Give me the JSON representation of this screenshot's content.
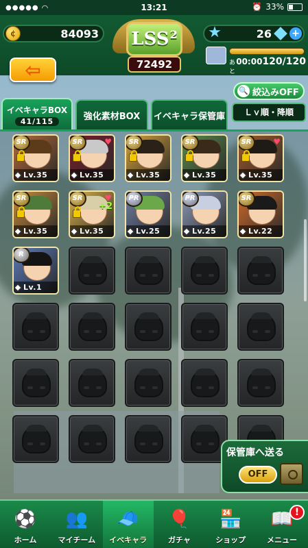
{
  "status_bar": {
    "signal": "●●●●●",
    "time": "13:21",
    "battery": "33%"
  },
  "header": {
    "coins": "84093",
    "rank_emblem": "LSS",
    "rank_superscript": "2",
    "rank_points": "72492",
    "stars": "26",
    "stamina_prefix": "あと",
    "stamina_timer": "00:00",
    "stamina_count": "120/120",
    "stamina_fraction": 1.0
  },
  "tabs": [
    {
      "label": "イベキャラBOX",
      "count": "41/115",
      "active": true
    },
    {
      "label": "強化素材BOX",
      "active": false
    },
    {
      "label": "イベキャラ保管庫",
      "active": false
    }
  ],
  "filter": {
    "label": "絞込みOFF",
    "sort": "Ｌｖ順・降順"
  },
  "characters": [
    {
      "rarity": "SR",
      "level": "Lv.35",
      "locked": true,
      "heart": false,
      "plus": "",
      "hair": "#5b3b1a",
      "bg": "#b66a3a"
    },
    {
      "rarity": "SR",
      "level": "Lv.35",
      "locked": true,
      "heart": true,
      "plus": "",
      "hair": "#c9c9c9",
      "bg": "#7a1c2a"
    },
    {
      "rarity": "SR",
      "level": "Lv.35",
      "locked": true,
      "heart": false,
      "plus": "",
      "hair": "#2a2118",
      "bg": "#d8a23a"
    },
    {
      "rarity": "SR",
      "level": "Lv.35",
      "locked": true,
      "heart": false,
      "plus": "",
      "hair": "#3a2a1a",
      "bg": "#5a8a4a"
    },
    {
      "rarity": "SR",
      "level": "Lv.35",
      "locked": true,
      "heart": true,
      "plus": "",
      "hair": "#1e1a16",
      "bg": "#a15a2a"
    },
    {
      "rarity": "SR",
      "level": "Lv.35",
      "locked": true,
      "heart": false,
      "plus": "",
      "hair": "#4e7a3a",
      "bg": "#c98a3a"
    },
    {
      "rarity": "SR",
      "level": "Lv.35",
      "locked": true,
      "heart": true,
      "plus": "+2",
      "hair": "#d8cfa8",
      "bg": "#d9b04a"
    },
    {
      "rarity": "PR",
      "level": "Lv.25",
      "locked": false,
      "heart": false,
      "plus": "",
      "hair": "#6aa84a",
      "bg": "#6f7ea0"
    },
    {
      "rarity": "PR",
      "level": "Lv.25",
      "locked": false,
      "heart": false,
      "plus": "",
      "hair": "#c8cfe0",
      "bg": "#8c9ab8"
    },
    {
      "rarity": "SR",
      "level": "Lv.22",
      "locked": false,
      "heart": false,
      "plus": "",
      "hair": "#1a1a1a",
      "bg": "#d06a2a"
    },
    {
      "rarity": "R",
      "level": "Lv.1",
      "locked": false,
      "heart": false,
      "plus": "",
      "hair": "#141414",
      "bg": "#5a7ab8"
    }
  ],
  "storage_send": {
    "label": "保管庫へ送る",
    "toggle": "OFF"
  },
  "nav": [
    {
      "label": "ホーム",
      "icon": "⚽",
      "active": false
    },
    {
      "label": "マイチーム",
      "icon": "👥",
      "active": false
    },
    {
      "label": "イベキャラ",
      "icon": "🧢",
      "active": true
    },
    {
      "label": "ガチャ",
      "icon": "🎈",
      "active": false
    },
    {
      "label": "ショップ",
      "icon": "🏪",
      "active": false
    },
    {
      "label": "メニュー",
      "icon": "📖",
      "active": false
    }
  ],
  "menu_alert": "!"
}
